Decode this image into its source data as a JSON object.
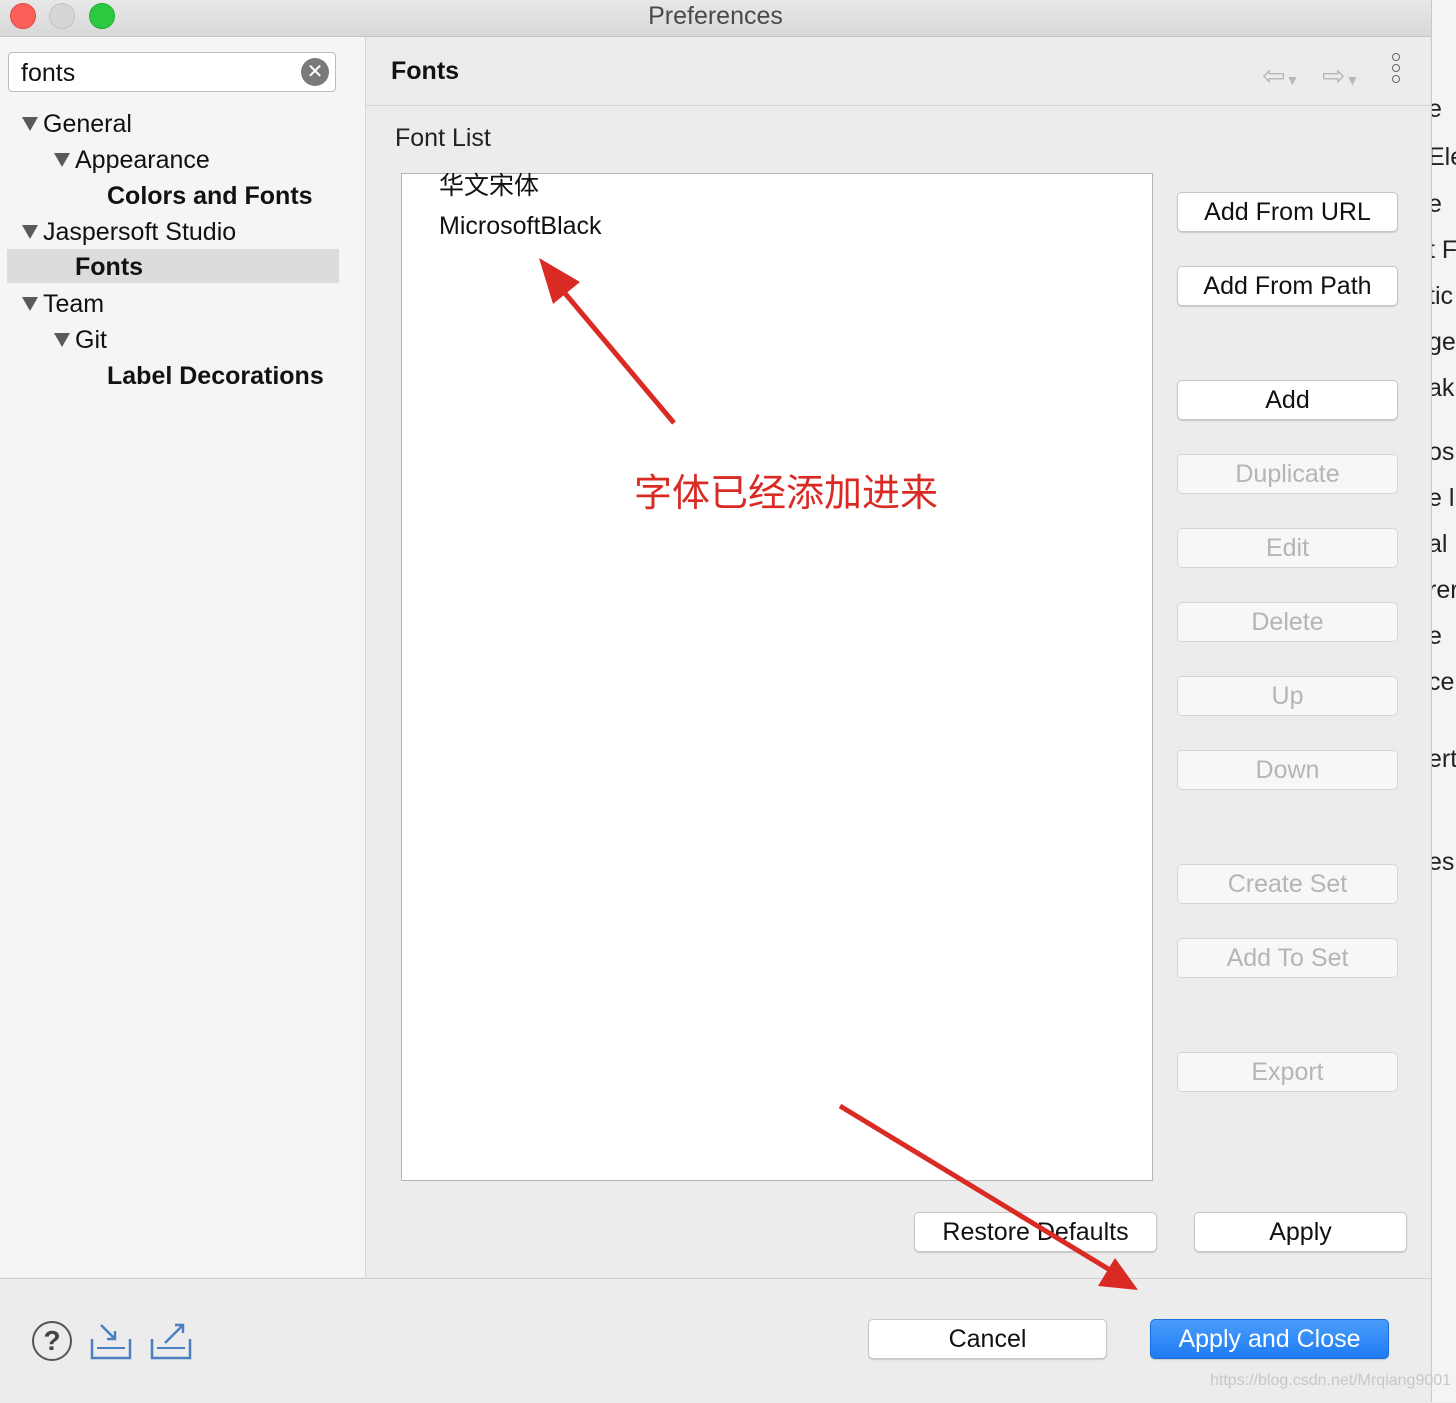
{
  "window": {
    "title": "Preferences"
  },
  "sidebar": {
    "search": {
      "value": "fonts",
      "placeholder": ""
    },
    "tree": [
      {
        "label": "General"
      },
      {
        "label": "Appearance"
      },
      {
        "label": "Colors and Fonts"
      },
      {
        "label": "Jaspersoft Studio"
      },
      {
        "label": "Fonts"
      },
      {
        "label": "Team"
      },
      {
        "label": "Git"
      },
      {
        "label": "Label Decorations"
      }
    ]
  },
  "main": {
    "title": "Fonts",
    "font_list_label": "Font List",
    "font_items": [
      "华文宋体",
      "MicrosoftBlack"
    ],
    "buttons": {
      "add_from_url": "Add From URL",
      "add_from_path": "Add From Path",
      "add": "Add",
      "duplicate": "Duplicate",
      "edit": "Edit",
      "delete": "Delete",
      "up": "Up",
      "down": "Down",
      "create_set": "Create Set",
      "add_to_set": "Add To Set",
      "export": "Export",
      "restore_defaults": "Restore Defaults",
      "apply": "Apply"
    }
  },
  "footer": {
    "help_symbol": "?",
    "cancel": "Cancel",
    "apply_and_close": "Apply and Close"
  },
  "background_window": {
    "fragments": [
      "e",
      "Ele",
      "e",
      "t F",
      "tic",
      "ge",
      "ak",
      "os",
      "e l",
      "al I",
      "rer",
      "e",
      "ce",
      "ert",
      "es"
    ]
  },
  "annotation": {
    "text": "字体已经添加进来",
    "color": "#d92a24"
  },
  "watermark": "https://blog.csdn.net/Mrqiang9001",
  "colors": {
    "accent": "#1e7bf2",
    "annotation": "#d92a24"
  }
}
